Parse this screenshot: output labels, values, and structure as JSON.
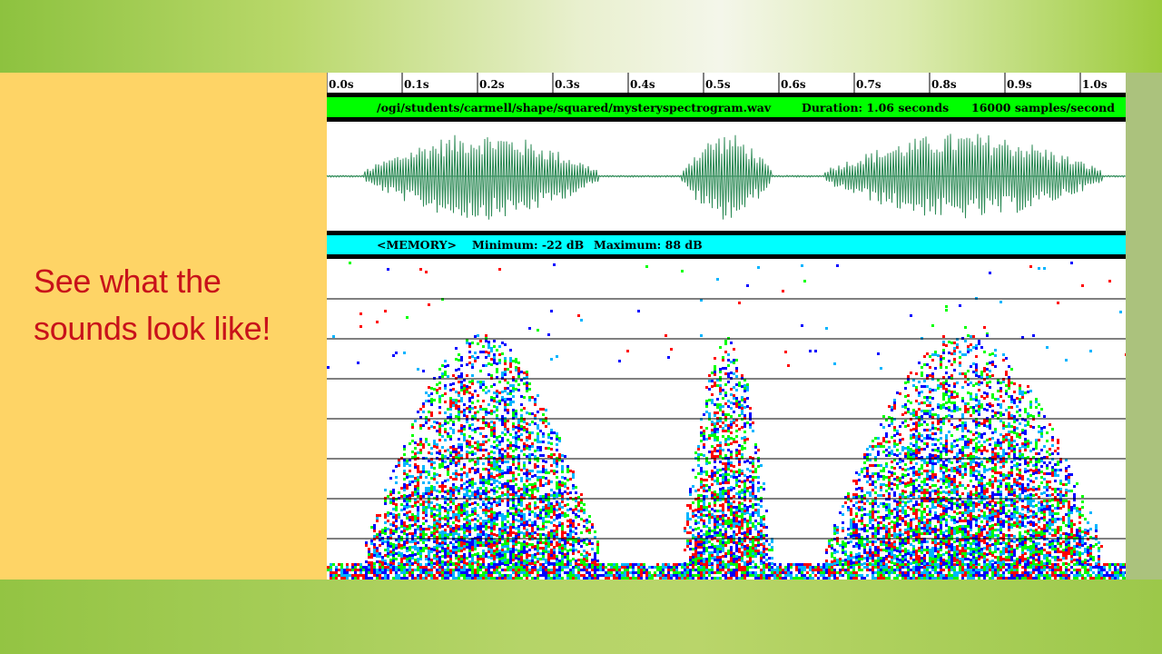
{
  "slide": {
    "caption": "See what the sounds look like!",
    "colors": {
      "left_panel": "#fed466",
      "caption_text": "#c8121a",
      "green_bar": "#00ff00",
      "cyan_bar": "#00ffff",
      "waveform": "#2e8b57"
    }
  },
  "spectrogram_window": {
    "time_ticks": [
      "0.0s",
      "0.1s",
      "0.2s",
      "0.3s",
      "0.4s",
      "0.5s",
      "0.6s",
      "0.7s",
      "0.8s",
      "0.9s",
      "1.0s"
    ],
    "file_bar": {
      "path": "/ogi/students/carmell/shape/squared/mysteryspectrogram.wav",
      "duration": "Duration: 1.06 seconds",
      "rate": "16000 samples/second"
    },
    "memory_bar": {
      "source": "<MEMORY>",
      "minimum": "Minimum: -22 dB",
      "maximum": "Maximum: 88 dB"
    },
    "spectrogram_palette": [
      "#0000ff",
      "#00ff00",
      "#ff0000",
      "#00b4ff",
      "#000000"
    ],
    "voiced_segments_seconds": [
      [
        0.05,
        0.36
      ],
      [
        0.47,
        0.59
      ],
      [
        0.66,
        1.03
      ]
    ]
  }
}
